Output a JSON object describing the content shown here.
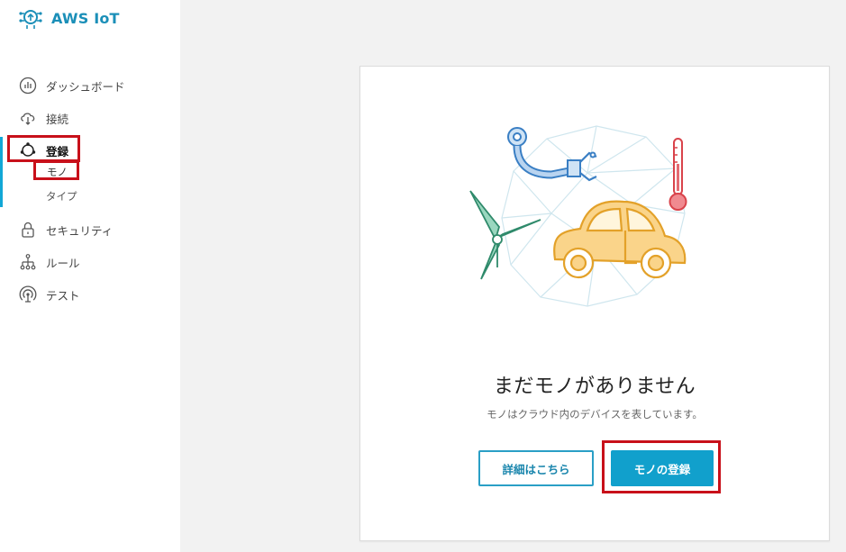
{
  "app": {
    "title": "AWS IoT"
  },
  "sidebar": {
    "items": [
      {
        "label": "ダッシュボード",
        "icon": "dashboard-icon"
      },
      {
        "label": "接続",
        "icon": "cloud-connect-icon"
      },
      {
        "label": "登録",
        "icon": "register-hub-icon"
      },
      {
        "label": "セキュリティ",
        "icon": "lock-icon"
      },
      {
        "label": "ルール",
        "icon": "rules-tree-icon"
      },
      {
        "label": "テスト",
        "icon": "test-signal-icon"
      }
    ],
    "subitems": [
      {
        "label": "モノ"
      },
      {
        "label": "タイプ"
      }
    ]
  },
  "main": {
    "empty_title": "まだモノがありません",
    "empty_subtitle": "モノはクラウド内のデバイスを表しています。",
    "details_button": "詳細はこちら",
    "register_button": "モノの登録"
  },
  "colors": {
    "accent": "#11a0cc",
    "highlight": "#c8101a",
    "brand": "#1b8fb8"
  }
}
